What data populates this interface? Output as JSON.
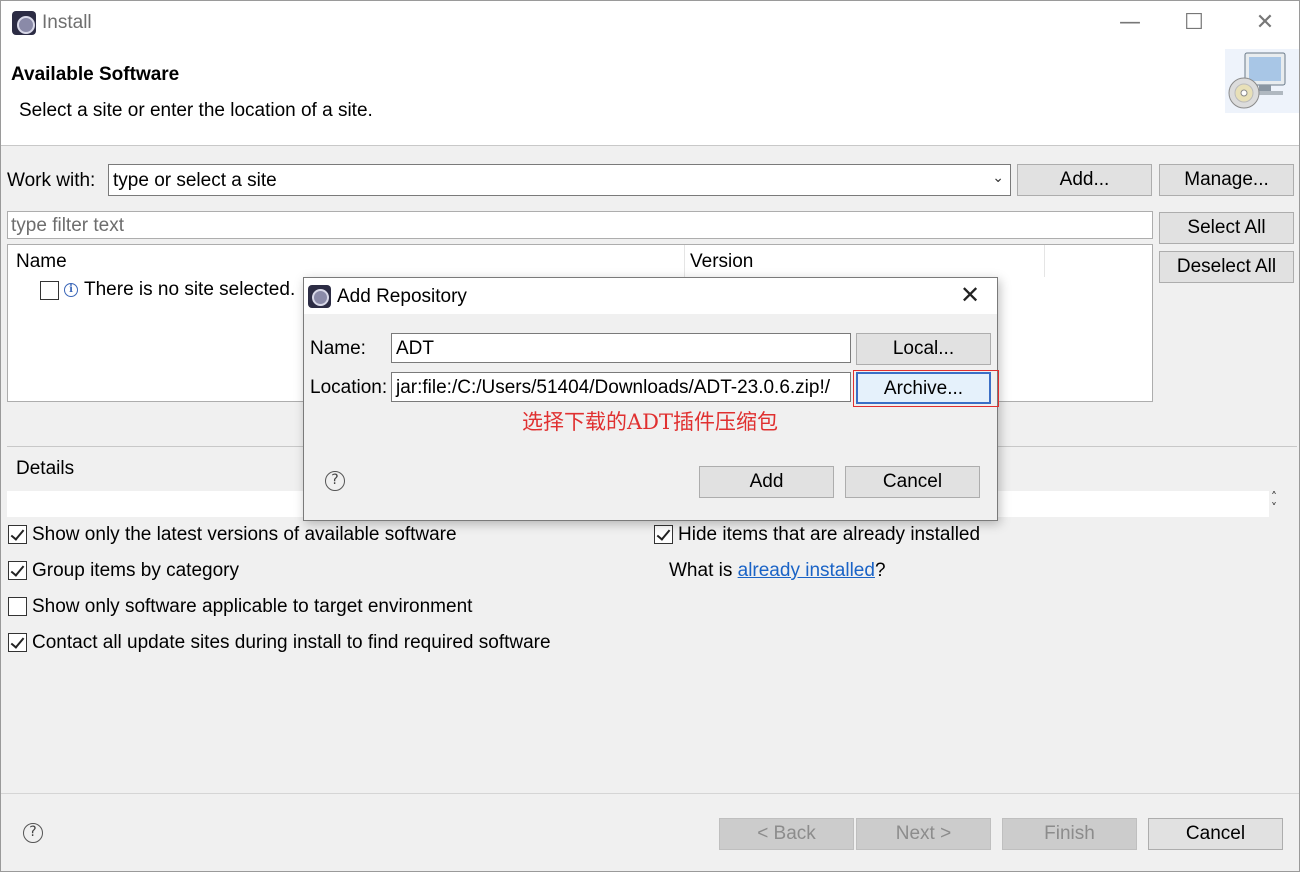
{
  "window": {
    "title": "Install",
    "minimize_icon": "minimize-icon",
    "maximize_icon": "maximize-icon",
    "close_icon": "close-icon"
  },
  "banner": {
    "title": "Available Software",
    "description": "Select a site or enter the location of a site."
  },
  "work_with": {
    "label": "Work with:",
    "value": "type or select a site",
    "add_label": "Add...",
    "manage_label": "Manage..."
  },
  "filter": {
    "placeholder": "type filter text"
  },
  "side_buttons": {
    "select_all": "Select All",
    "deselect_all": "Deselect All"
  },
  "table": {
    "columns": [
      "Name",
      "Version"
    ],
    "rows": [
      {
        "name": "There is no site selected.",
        "version": "",
        "checked": false
      }
    ]
  },
  "details": {
    "label": "Details"
  },
  "options": [
    {
      "label": "Show only the latest versions of available software",
      "checked": true
    },
    {
      "label": "Group items by category",
      "checked": true
    },
    {
      "label": "Show only software applicable to target environment",
      "checked": false
    },
    {
      "label": "Contact all update sites during install to find required software",
      "checked": true
    },
    {
      "label": "Hide items that are already installed",
      "checked": true
    }
  ],
  "installed_text": {
    "prefix": "What is ",
    "link": "already installed",
    "suffix": "?"
  },
  "footer": {
    "back": "< Back",
    "next": "Next >",
    "finish": "Finish",
    "cancel": "Cancel"
  },
  "dialog": {
    "title": "Add Repository",
    "name_label": "Name:",
    "name_value": "ADT",
    "location_label": "Location:",
    "location_value": "jar:file:/C:/Users/51404/Downloads/ADT-23.0.6.zip!/",
    "local_button": "Local...",
    "archive_button": "Archive...",
    "annotation": "选择下载的ADT插件压缩包",
    "add_button": "Add",
    "cancel_button": "Cancel"
  },
  "colors": {
    "annotation": "#e03030",
    "link": "#1a63c6",
    "window_bg": "#f0f0f0"
  }
}
